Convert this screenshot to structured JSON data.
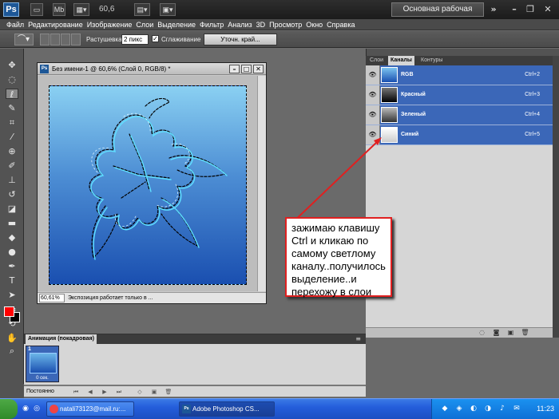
{
  "app": {
    "logo": "Ps",
    "zoom": "60,6",
    "workspace": "Основная рабочая среда"
  },
  "menu": [
    "Файл",
    "Редактирование",
    "Изображение",
    "Слои",
    "Выделение",
    "Фильтр",
    "Анализ",
    "3D",
    "Просмотр",
    "Окно",
    "Справка"
  ],
  "options": {
    "feather_label": "Растушевка:",
    "feather_value": "2 пикс",
    "antialias_label": "Сглаживание",
    "refine_label": "Уточн. край..."
  },
  "document": {
    "title": "Без имени-1 @ 60,6% (Слой 0, RGB/8) *",
    "zoom": "60,61%",
    "status": "Экспозиция работает только в ..."
  },
  "panel": {
    "tabs": [
      "Слои",
      "Каналы",
      "Контуры"
    ],
    "active_tab": "Каналы",
    "channels": [
      {
        "name": "RGB",
        "key": "Ctrl+2"
      },
      {
        "name": "Красный",
        "key": "Ctrl+3"
      },
      {
        "name": "Зеленый",
        "key": "Ctrl+4"
      },
      {
        "name": "Синий",
        "key": "Ctrl+5"
      }
    ]
  },
  "annotation": {
    "text": "зажимаю клавишу Ctrl и кликаю по самому светлому каналу..получилось выделение..и перехожу в слои",
    "color": "#e02020"
  },
  "animation": {
    "title": "Анимация (покадровая)",
    "frame_number": "1",
    "frame_delay": "0 сек.",
    "loop": "Постоянно"
  },
  "taskbar": {
    "task1": "natali73123@mail.ru:...",
    "task2": "Adobe Photoshop CS...",
    "time": "11:23"
  },
  "colors": {
    "foreground": "#ff0000",
    "background": "#000000",
    "selection_highlight": "#3b67b8"
  }
}
